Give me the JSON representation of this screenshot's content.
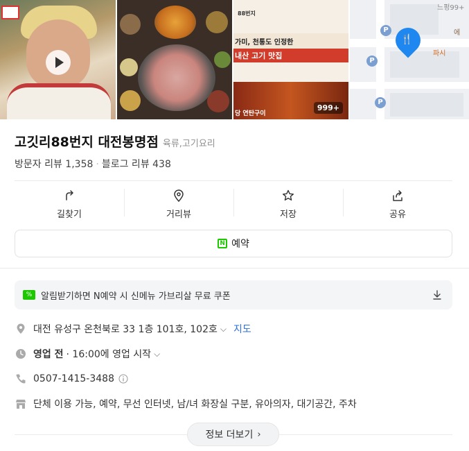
{
  "gallery": {
    "photo_count": "999+",
    "poster_line1": "88번지",
    "poster_line2": "가미, 천통도 인정한",
    "poster_line3": "내산 고기 맛집",
    "poster_line4": "당 연탄구이",
    "map_label1": "에",
    "map_label2": "파시",
    "map_label3": "느펑99+"
  },
  "place": {
    "name": "고깃리88번지 대전봉명점",
    "category": "육류,고기요리",
    "visitor_reviews": "방문자 리뷰 1,358",
    "separator": "·",
    "blog_reviews": "블로그 리뷰 438"
  },
  "actions": {
    "directions": "길찾기",
    "streetview": "거리뷰",
    "save": "저장",
    "share": "공유"
  },
  "reserve": {
    "n_icon": "N",
    "label": "예약"
  },
  "coupon": {
    "text": "알림받기하면 N예약 시 신메뉴 가브리살 무료 쿠폰"
  },
  "info": {
    "address": "대전 유성구 온천북로 33 1층 101호, 102호",
    "map_link": "지도",
    "hours_status": "영업 전",
    "hours_detail": "· 16:00에 영업 시작",
    "phone": "0507-1415-3488",
    "amenities": "단체 이용 가능, 예약, 무선 인터넷, 남/녀 화장실 구분, 유아의자, 대기공간, 주차"
  },
  "more_button": "정보 더보기",
  "colors": {
    "naver_green": "#1ec800",
    "link_blue": "#2d6fdd",
    "map_pin": "#1e88f0"
  }
}
